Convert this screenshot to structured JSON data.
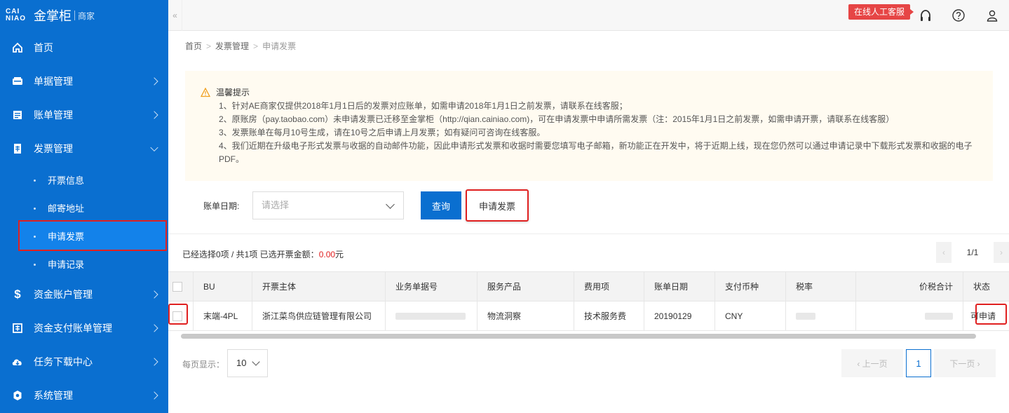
{
  "brand": {
    "logo_top": "CAI",
    "logo_bottom": "NIAO",
    "name": "金掌柜",
    "sub": "商家"
  },
  "sidebar": {
    "items": [
      {
        "label": "首页",
        "icon": "home-icon",
        "chevron": false
      },
      {
        "label": "单据管理",
        "icon": "document-icon",
        "chevron": true
      },
      {
        "label": "账单管理",
        "icon": "bill-icon",
        "chevron": true
      },
      {
        "label": "发票管理",
        "icon": "invoice-icon",
        "chevron": true,
        "open": true
      },
      {
        "label": "资金账户管理",
        "icon": "dollar-icon",
        "chevron": true
      },
      {
        "label": "资金支付账单管理",
        "icon": "payment-icon",
        "chevron": true
      },
      {
        "label": "任务下载中心",
        "icon": "cloud-download-icon",
        "chevron": true
      },
      {
        "label": "系统管理",
        "icon": "gear-icon",
        "chevron": true
      }
    ],
    "sub_items": [
      {
        "label": "开票信息"
      },
      {
        "label": "邮寄地址"
      },
      {
        "label": "申请发票",
        "active": true
      },
      {
        "label": "申请记录"
      }
    ]
  },
  "topbar": {
    "collapse": "«",
    "service": "在线人工客服"
  },
  "breadcrumb": {
    "home": "首页",
    "section": "发票管理",
    "current": "申请发票"
  },
  "notice": {
    "title": "温馨提示",
    "lines": [
      "1、针对AE商家仅提供2018年1月1日后的发票对应账单，如需申请2018年1月1日之前发票，请联系在线客服；",
      "2、原账房（pay.taobao.com）未申请发票已迁移至金掌柜（http://qian.cainiao.com)，可在申请发票中申请所需发票（注：2015年1月1日之前发票，如需申请开票，请联系在线客服）",
      "3、发票账单在每月10号生成，请在10号之后申请上月发票；如有疑问可咨询在线客服。",
      "4、我们近期在升级电子形式发票与收据的自动邮件功能，因此申请形式发票和收据时需要您填写电子邮箱，新功能正在开发中，将于近期上线，现在您仍然可以通过申请记录中下载形式发票和收据的电子PDF。"
    ]
  },
  "filter": {
    "date_label": "账单日期:",
    "date_placeholder": "请选择",
    "query_label": "查询",
    "apply_label": "申请发票"
  },
  "summary": {
    "text": "已经选择0项 / 共1项   已选开票金额：",
    "amount": "0.00",
    "unit": "元"
  },
  "mini_pager": {
    "page": "1/1",
    "prev": "‹",
    "next": "›"
  },
  "table": {
    "headers": [
      "BU",
      "开票主体",
      "业务单据号",
      "服务产品",
      "费用项",
      "账单日期",
      "支付币种",
      "税率",
      "价税合计",
      "状态"
    ],
    "rows": [
      {
        "bu": "末端-4PL",
        "entity": "浙江菜鸟供应链管理有限公司",
        "service": "物流洞察",
        "fee": "技术服务费",
        "date": "20190129",
        "currency": "CNY",
        "status": "可申请"
      }
    ]
  },
  "footer": {
    "per_page_label": "每页显示：",
    "per_page": "10",
    "prev": "‹ 上一页",
    "current": "1",
    "next": "下一页 ›"
  },
  "colors": {
    "primary": "#0a6fd0",
    "highlight": "#e02020",
    "notice_bg": "#fffbf1"
  }
}
